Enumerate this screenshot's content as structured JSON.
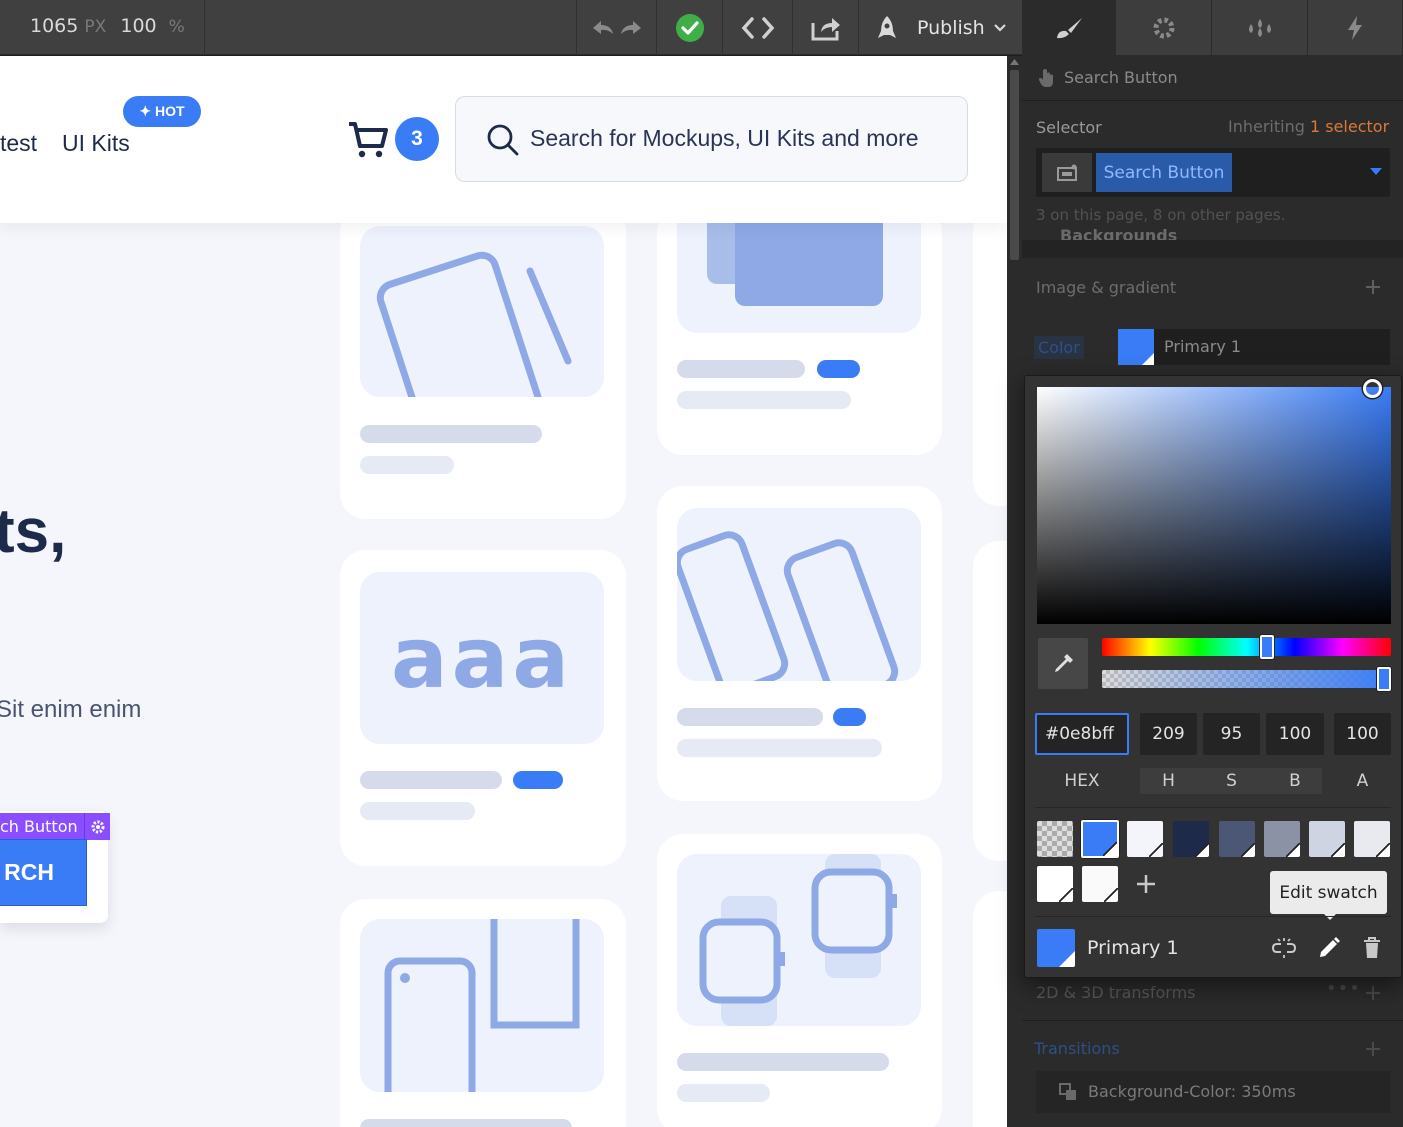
{
  "topbar": {
    "width_value": "1065",
    "width_unit": "PX",
    "zoom_value": "100",
    "zoom_unit": "%",
    "publish_label": "Publish"
  },
  "site": {
    "nav_partial": "test",
    "nav_ui_kits": "UI Kits",
    "hot_badge": "✦ HOT",
    "cart_count": "3",
    "search_placeholder": "Search for Mockups, UI Kits and more",
    "hero_fragment": "ts,",
    "body_fragment": "Sit enim enim",
    "selected_element_tag": "ch Button",
    "search_button_fragment": "RCH",
    "aaa_text": "aaa"
  },
  "panel": {
    "element_name": "Search Button",
    "selector_label": "Selector",
    "inheriting_label": "Inheriting",
    "inheriting_count": "1 selector",
    "selector_chip": "Search Button",
    "selector_usage": "3 on this page, 8 on other pages.",
    "backgrounds_heading": "Backgrounds",
    "image_gradient_label": "Image & gradient",
    "color_label": "Color",
    "color_swatch_name": "Primary 1",
    "transforms_label": "2D & 3D transforms",
    "transitions_label": "Transitions",
    "transition_item": "Background-Color: 350ms"
  },
  "picker": {
    "hex": "#0e8bff",
    "h": "209",
    "s": "95",
    "b": "100",
    "a": "100",
    "hex_label": "HEX",
    "h_label": "H",
    "s_label": "S",
    "b_label": "B",
    "a_label": "A",
    "tooltip": "Edit swatch",
    "swatch_name": "Primary 1",
    "hue_fraction": 0.58,
    "alpha_fraction": 1.0
  },
  "colors": {
    "primary": "#3a7cf6",
    "accent_purple": "#8a4dff",
    "success": "#3fae4a",
    "link_blue": "#3a6fd8",
    "warning_orange": "#d9793a",
    "illustration": "#8fa9e6"
  }
}
